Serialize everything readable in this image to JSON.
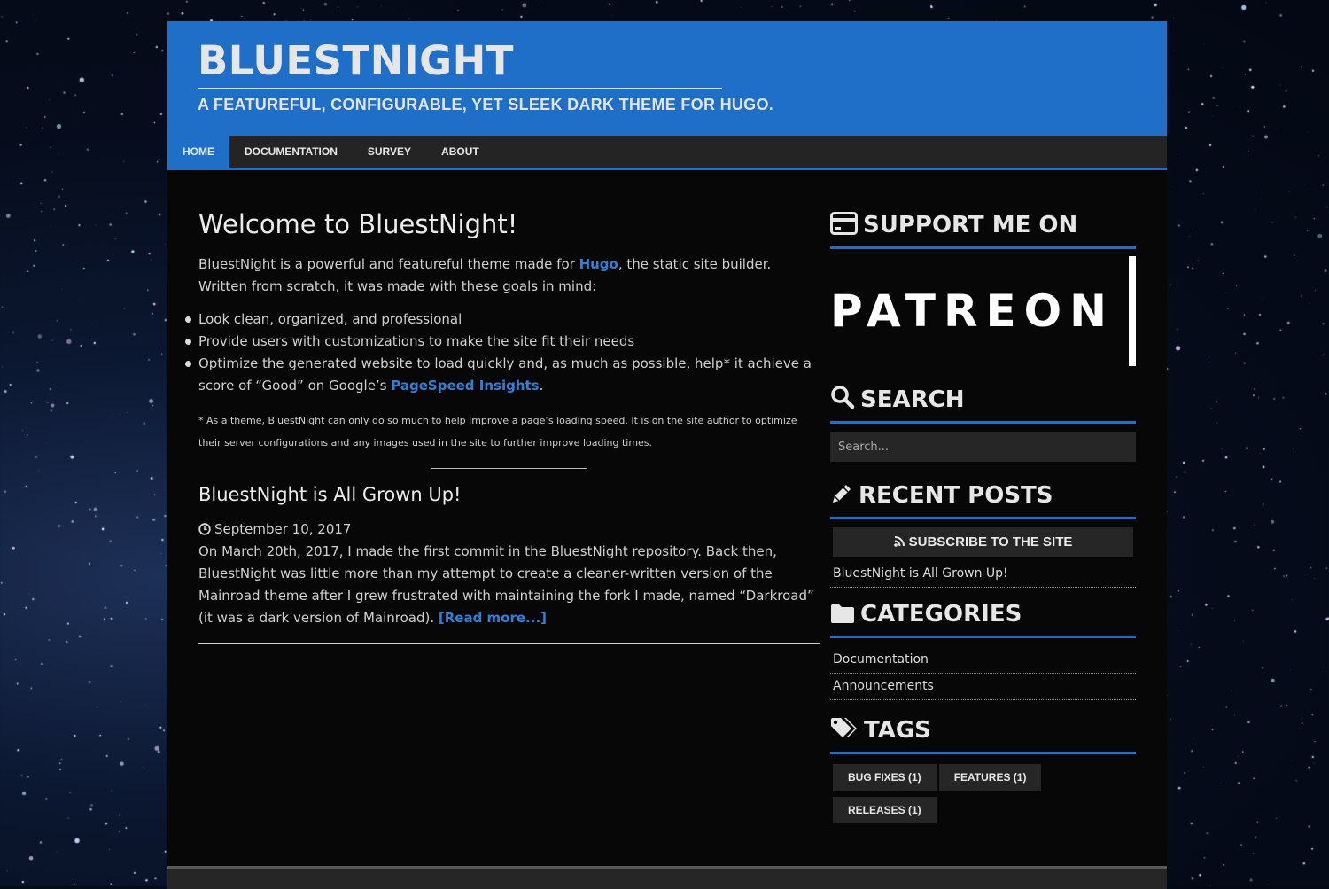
{
  "header": {
    "title": "BLUESTNIGHT",
    "tagline": "A FEATUREFUL, CONFIGURABLE, YET SLEEK DARK THEME FOR HUGO."
  },
  "nav": {
    "items": [
      {
        "label": "HOME",
        "active": true
      },
      {
        "label": "DOCUMENTATION",
        "active": false
      },
      {
        "label": "SURVEY",
        "active": false
      },
      {
        "label": "ABOUT",
        "active": false
      }
    ]
  },
  "main": {
    "welcome_title": "Welcome to BluestNight!",
    "intro_before": "BluestNight is a powerful and featureful theme made for ",
    "intro_link": "Hugo",
    "intro_after": ", the static site builder. Written from scratch, it was made with these goals in mind:",
    "goals": [
      "Look clean, organized, and professional",
      "Provide users with customizations to make the site fit their needs"
    ],
    "goal3_before": "Optimize the generated website to load quickly and, as much as possible, help* it achieve a score of “Good” on Google’s ",
    "goal3_link": "PageSpeed Insights",
    "goal3_after": ".",
    "footnote": "* As a theme, BluestNight can only do so much to help improve a page’s loading speed. It is on the site author to optimize their server configurations and any images used in the site to further improve loading times.",
    "post": {
      "title": "BluestNight is All Grown Up!",
      "date": "September 10, 2017",
      "summary": "On March 20th, 2017, I made the first commit in the BluestNight repository. Back then, BluestNight was little more than my attempt to create a cleaner-written version of the Mainroad theme after I grew frustrated with maintaining the fork I made, named “Darkroad” (it was a dark version of Mainroad). ",
      "read_more": "[Read more...]"
    }
  },
  "sidebar": {
    "support_title": "SUPPORT ME ON",
    "patreon_text": "PATREON",
    "search_title": "SEARCH",
    "search_placeholder": "Search...",
    "recent_title": "RECENT POSTS",
    "subscribe_label": "SUBSCRIBE TO THE SITE",
    "recent_posts": [
      "BluestNight is All Grown Up!"
    ],
    "categories_title": "CATEGORIES",
    "categories": [
      "Documentation",
      "Announcements"
    ],
    "tags_title": "TAGS",
    "tags": [
      "BUG FIXES (1)",
      "FEATURES (1)",
      "RELEASES (1)"
    ]
  },
  "colors": {
    "accent": "#1f6fc9",
    "link": "#2f80d9",
    "page_bg": "#070707",
    "widget_bg": "#262626"
  }
}
